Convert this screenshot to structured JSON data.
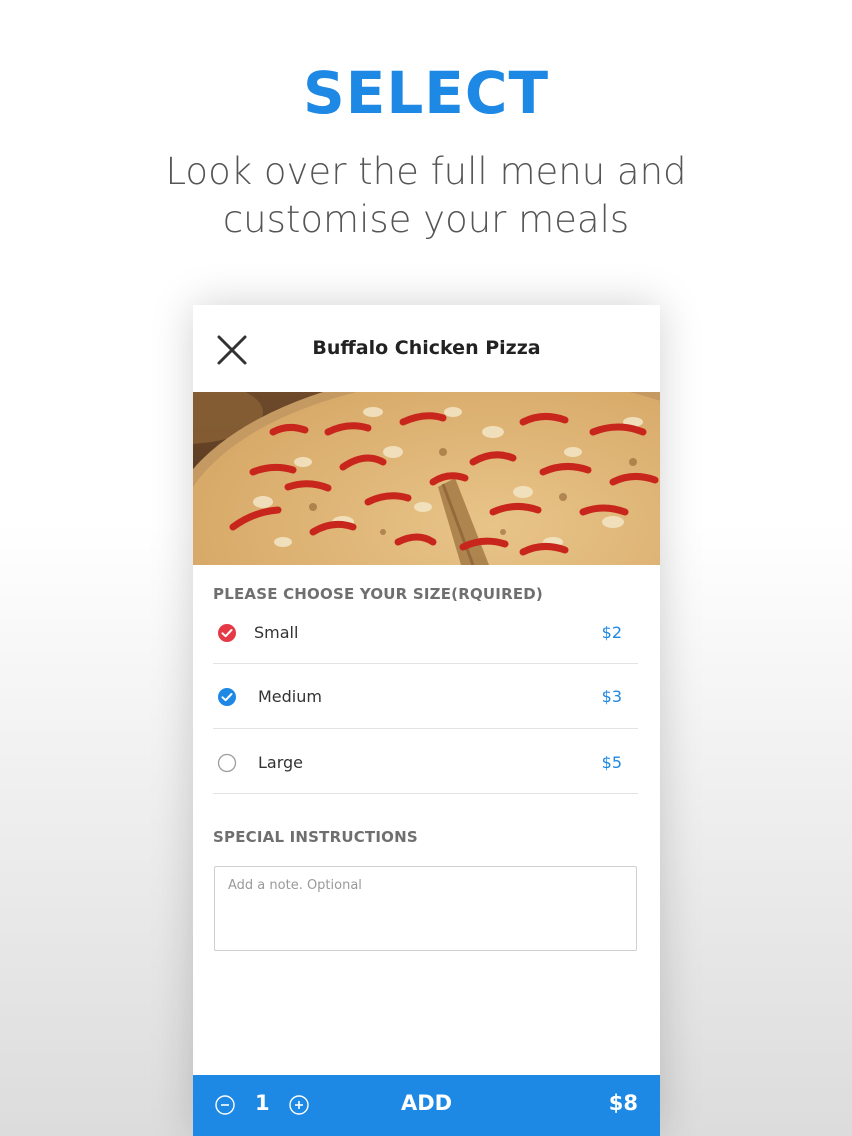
{
  "promo": {
    "headline": "SELECT",
    "subtitle_line1": "Look over the full menu and",
    "subtitle_line2": "customise your meals"
  },
  "item": {
    "title": "Buffalo Chicken Pizza",
    "image_icon": "pizza-photo"
  },
  "size_section": {
    "label": "PLEASE  CHOOSE YOUR SIZE(RQUIRED)",
    "options": [
      {
        "name": "Small",
        "price": "$2",
        "state": "checked-red"
      },
      {
        "name": "Medium",
        "price": "$3",
        "state": "checked-blue"
      },
      {
        "name": "Large",
        "price": "$5",
        "state": "unchecked"
      }
    ]
  },
  "instructions": {
    "label": "SPECIAL INSTRUCTIONS",
    "placeholder": "Add a note. Optional",
    "value": ""
  },
  "order_bar": {
    "quantity": "1",
    "add_label": "ADD",
    "total": "$8"
  },
  "colors": {
    "accent_blue": "#1e88e5",
    "check_red": "#e53945",
    "bar_blue": "#1e88e5"
  }
}
